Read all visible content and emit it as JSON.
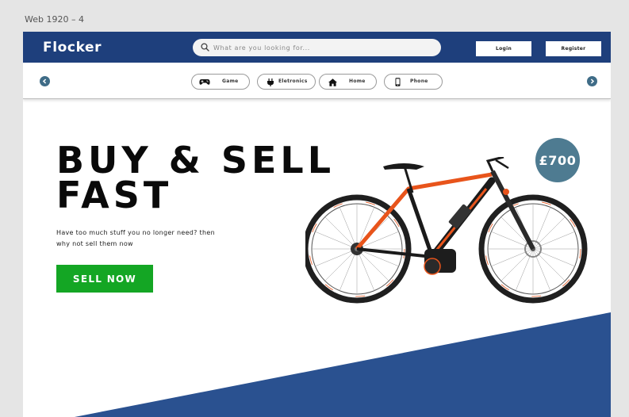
{
  "canvas": {
    "label": "Web 1920 – 4"
  },
  "header": {
    "brand": "Flocker",
    "search_placeholder": "What are you looking for...",
    "login_label": "Login",
    "register_label": "Register"
  },
  "categories": [
    {
      "label": "Game",
      "icon": "gamepad-icon"
    },
    {
      "label": "Eletronics",
      "icon": "plug-icon"
    },
    {
      "label": "Home",
      "icon": "house-icon"
    },
    {
      "label": "Phone",
      "icon": "phone-icon"
    }
  ],
  "hero": {
    "title_line1": "BUY & SELL",
    "title_line2": "FAST",
    "subtitle_line1": "Have too much stuff you no longer need? then",
    "subtitle_line2": "why not sell them now",
    "cta_label": "SELL NOW",
    "price": "£700"
  },
  "colors": {
    "header_bg": "#1e3f7c",
    "cta_green": "#14a624",
    "price_badge": "#4e7b91",
    "accent_wedge": "#2a5190",
    "bike_orange": "#e8541b"
  }
}
